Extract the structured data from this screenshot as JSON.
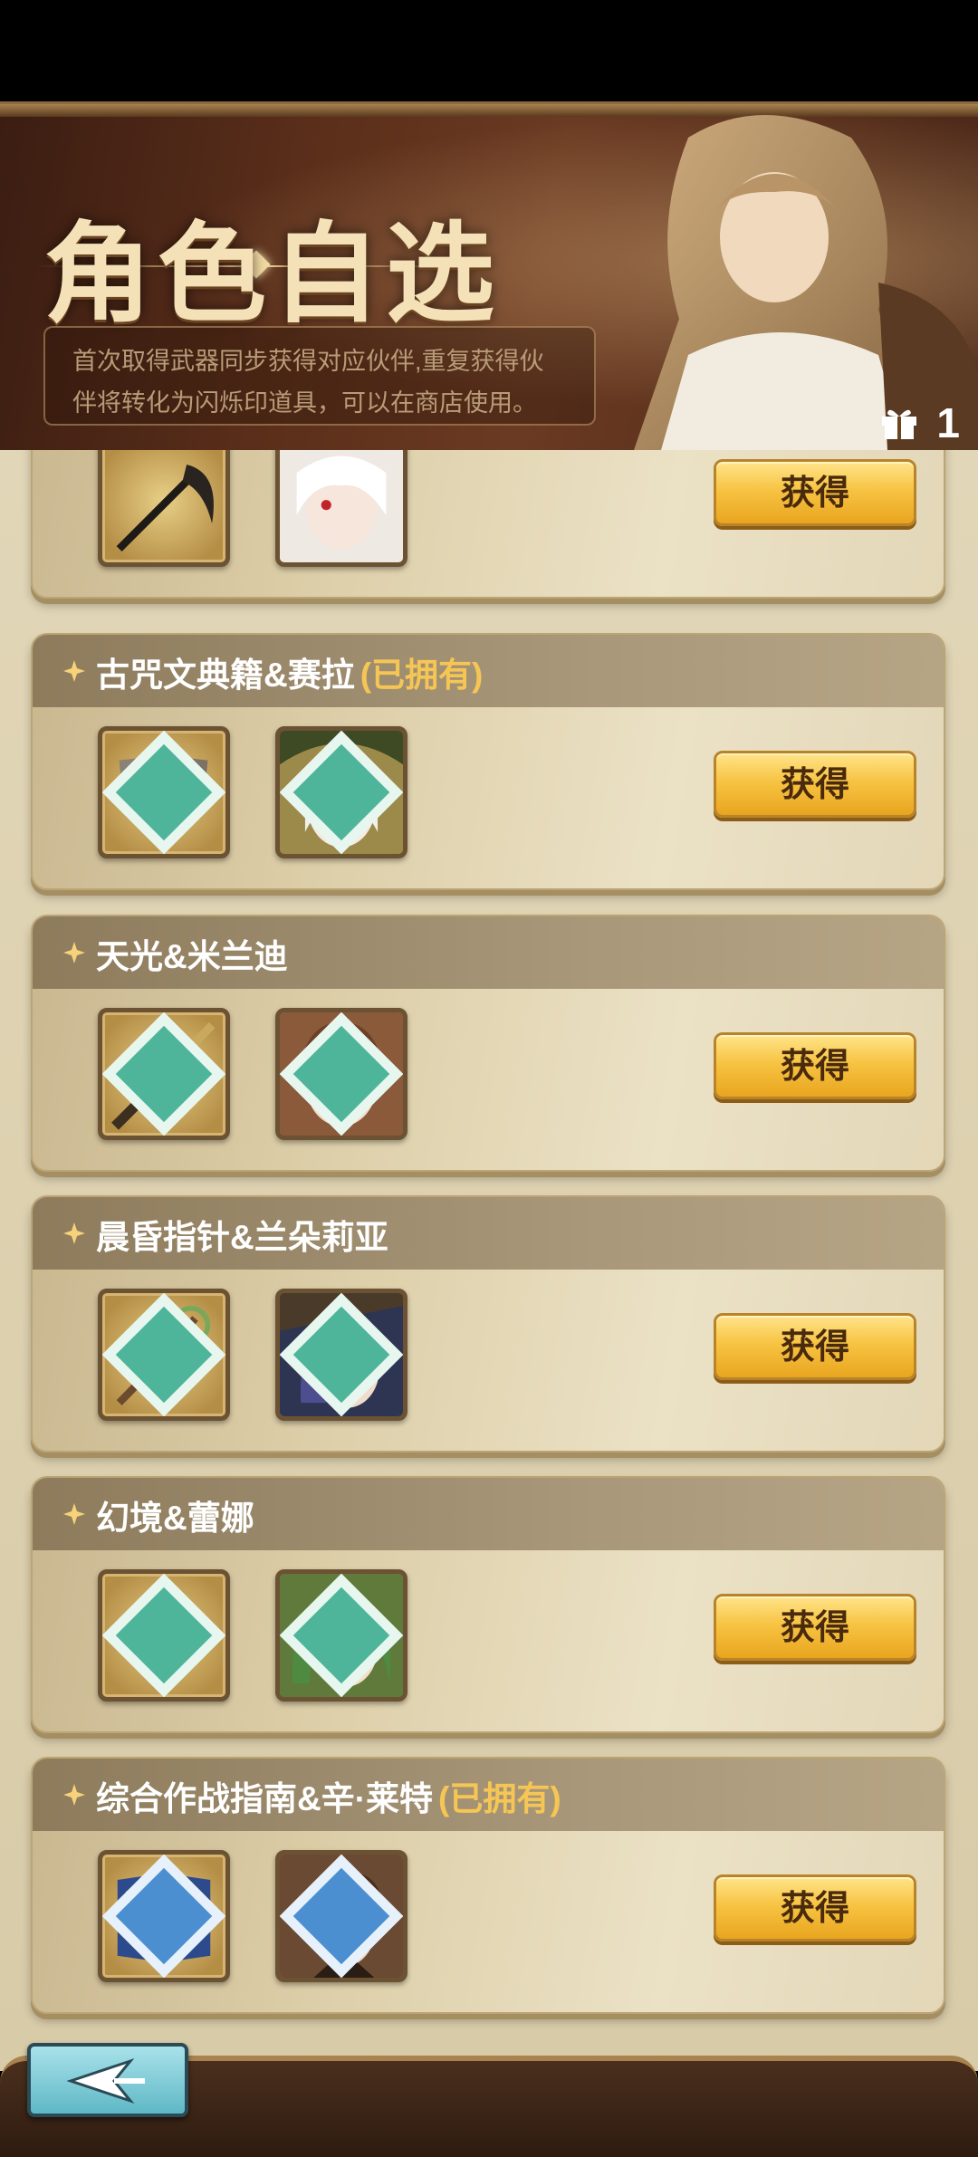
{
  "banner": {
    "title": "角色自选",
    "description": "首次取得武器同步获得对应伙伴,重复获得伙伴将转化为闪烁印道具，可以在商店使用。",
    "gift_count": "1"
  },
  "claim_label": "获得",
  "owned_label": "(已拥有)",
  "cards": [
    {
      "title": "",
      "owned": ""
    },
    {
      "title": "古咒文典籍&赛拉",
      "owned": "(已拥有)"
    },
    {
      "title": "天光&米兰迪",
      "owned": ""
    },
    {
      "title": "晨昏指针&兰朵莉亚",
      "owned": ""
    },
    {
      "title": "幻境&蕾娜",
      "owned": ""
    },
    {
      "title": "综合作战指南&辛·莱特",
      "owned": "(已拥有)"
    }
  ],
  "icons": {
    "star": "star-icon",
    "gem": "rarity-gem-icon",
    "gift": "gift-icon",
    "back": "back-arrow-icon"
  },
  "colors": {
    "claim_button": "#f7c443",
    "owned_tag": "#f6c655",
    "header_band": "#8d7b5c",
    "gem_green": "#4fb59a",
    "gem_blue": "#4c8fd0"
  }
}
